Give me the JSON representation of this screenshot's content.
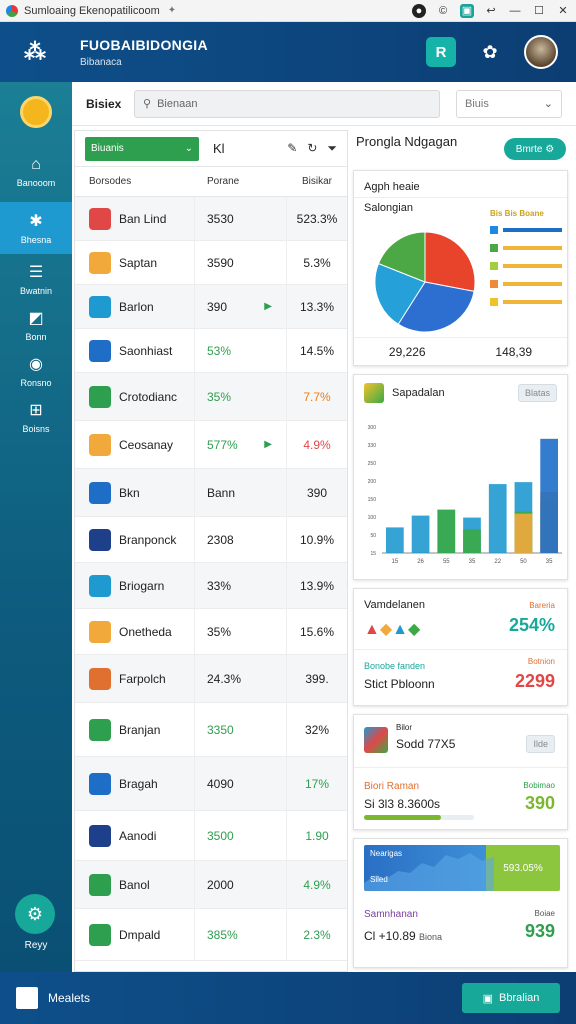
{
  "titlebar": {
    "title": "Sumloaing Ekenopatilicoom"
  },
  "header": {
    "title": "FUOBAIBIDONGIA",
    "subtitle": "Bibanaca",
    "btn": "R"
  },
  "sidebar": {
    "items": [
      {
        "label": "Banooom",
        "icon": "home-icon"
      },
      {
        "label": "Bhesna",
        "icon": "chart-icon"
      },
      {
        "label": "Bwatnin",
        "icon": "list-icon"
      },
      {
        "label": "Bonn",
        "icon": "doc-icon"
      },
      {
        "label": "Ronsno",
        "icon": "eye-icon"
      },
      {
        "label": "Boisns",
        "icon": "grid-icon"
      }
    ],
    "settings_label": "Reyy"
  },
  "search": {
    "label": "Bisiex",
    "placeholder": "Bienaan",
    "dropdown": "Biuis"
  },
  "table": {
    "dropdown": "Biuanis",
    "x_label": "Kl",
    "headers": [
      "Borsodes",
      "Porane",
      "Bisikar"
    ],
    "rows": [
      {
        "name": "Ban Lind",
        "v1": "3530",
        "v2": "523.3%",
        "c1": "",
        "c2": ""
      },
      {
        "name": "Saptan",
        "v1": "3590",
        "v2": "5.3%",
        "c1": "",
        "c2": ""
      },
      {
        "name": "Barlon",
        "v1": "390",
        "v2": "13.3%",
        "c1": "",
        "c2": "",
        "arrow": true
      },
      {
        "name": "Saonhiast",
        "v1": "53%",
        "v2": "14.5%",
        "c1": "green",
        "c2": ""
      },
      {
        "name": "Crotodianc",
        "v1": "35%",
        "v2": "7.7%",
        "c1": "green",
        "c2": "orange"
      },
      {
        "name": "Ceosanay",
        "v1": "577%",
        "v2": "4.9%",
        "c1": "green",
        "c2": "red",
        "arrow": true
      },
      {
        "name": "Bkn",
        "v1": "Bann",
        "v2": "390",
        "c1": "",
        "c2": ""
      },
      {
        "name": "Branponck",
        "v1": "2308",
        "v2": "10.9%",
        "c1": "",
        "c2": ""
      },
      {
        "name": "Briogarn",
        "v1": "33%",
        "v2": "13.9%",
        "c1": "",
        "c2": ""
      },
      {
        "name": "Onetheda",
        "v1": "35%",
        "v2": "15.6%",
        "c1": "",
        "c2": ""
      },
      {
        "name": "Farpolch",
        "v1": "24.3%",
        "v2": "399.",
        "c1": "",
        "c2": ""
      },
      {
        "name": "Branjan",
        "v1": "3350",
        "v2": "32%",
        "c1": "green",
        "c2": ""
      },
      {
        "name": "Bragah",
        "v1": "4090",
        "v2": "17%",
        "c1": "",
        "c2": "green"
      },
      {
        "name": "Aanodi",
        "v1": "3500",
        "v2": "1.90",
        "c1": "green",
        "c2": "green"
      },
      {
        "name": "Banol",
        "v1": "2000",
        "v2": "4.9%",
        "c1": "",
        "c2": "green"
      },
      {
        "name": "Dmpald",
        "v1": "385%",
        "v2": "2.3%",
        "c1": "green",
        "c2": "green"
      }
    ]
  },
  "right": {
    "title": "Prongla Ndgagan",
    "btn": "Bmrte",
    "pie_card": {
      "head": "Agph heaie",
      "sub": "Salongian",
      "legend_title": "Bis Bis Boane",
      "foot1": "29,226",
      "foot2": "148,39"
    },
    "bar_card": {
      "head": "Sapadalan",
      "pill": "Blatas",
      "x_ticks": [
        "15",
        "26",
        "55",
        "35",
        "22",
        "50",
        "35"
      ],
      "y_ticks": [
        "300",
        "330",
        "250",
        "200",
        "150",
        "100",
        "50",
        "15"
      ]
    },
    "card3": {
      "head": "Vamdelanen",
      "label1": "Bareria",
      "value1": "254%",
      "label2": "Bonobe fanden",
      "text2": "Stict Pbloonn",
      "label3": "Botnion",
      "value2": "2299"
    },
    "card4": {
      "head": "Bilor",
      "text": "Sodd 77X5",
      "pill": "Ilde",
      "label1": "Biori Raman",
      "text2": "Si 3l3 8.3600s",
      "label2": "Bobimao",
      "value": "390"
    },
    "card5": {
      "label": "Nearigas",
      "sub": "Siled",
      "pct": "593.05%",
      "head": "Samnhanan",
      "text": "Cl +10.89",
      "text_tail": "Biona",
      "label2": "Boiae",
      "value": "939"
    }
  },
  "footer": {
    "left": "Mealets",
    "btn": "Bbralian"
  },
  "chart_data": [
    {
      "type": "pie",
      "title": "Salongian",
      "values": [
        28,
        31,
        22,
        19
      ],
      "colors": [
        "#e8442b",
        "#2c6fd0",
        "#26a0d8",
        "#4ca845"
      ]
    },
    {
      "type": "bar",
      "title": "Sapadalan",
      "categories": [
        "15",
        "26",
        "55",
        "35",
        "22",
        "50",
        "35"
      ],
      "series": [
        {
          "values": [
            65,
            95,
            110,
            90,
            175,
            180,
            130
          ],
          "color": "#1f9ad0"
        },
        {
          "values": [
            0,
            0,
            110,
            60,
            0,
            105,
            0
          ],
          "color": "#3aaa45"
        },
        {
          "values": [
            0,
            0,
            0,
            0,
            0,
            100,
            155
          ],
          "color": "#f2a93b"
        },
        {
          "values": [
            0,
            0,
            0,
            0,
            0,
            0,
            290
          ],
          "color": "#1e6ec8"
        }
      ],
      "ylim": [
        0,
        320
      ]
    }
  ]
}
